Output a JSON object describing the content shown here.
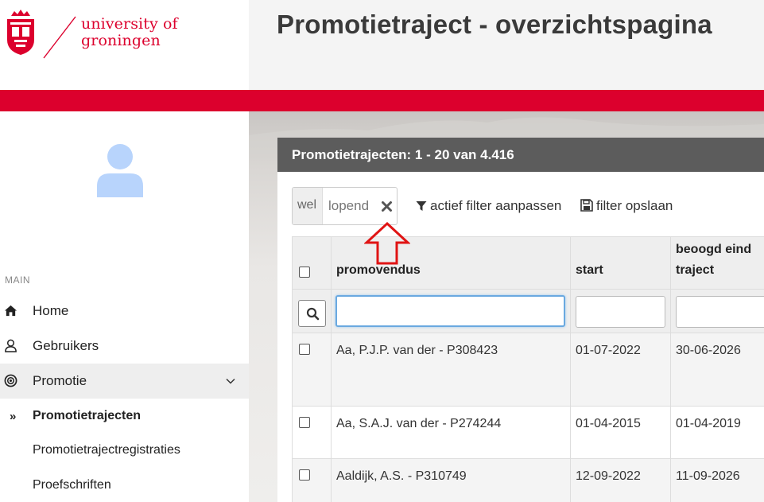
{
  "header": {
    "logo_line1": "university of",
    "logo_line2": "groningen",
    "title": "Promotietraject - overzichtspagina"
  },
  "colors": {
    "brand": "#dc002d",
    "panel_header": "#5c5c5c",
    "avatar": "#b8d4fc",
    "focus": "#6aa9e0"
  },
  "sidebar": {
    "section_label": "MAIN",
    "items": [
      {
        "label": "Home",
        "icon": "home-icon"
      },
      {
        "label": "Gebruikers",
        "icon": "user-icon"
      },
      {
        "label": "Promotie",
        "icon": "target-icon",
        "expanded": true
      }
    ],
    "sub_items": [
      {
        "label": "Promotietrajecten",
        "current": true,
        "bullet": "»"
      },
      {
        "label": "Promotietrajectregistraties"
      },
      {
        "label": "Proefschriften"
      }
    ]
  },
  "panel": {
    "title": "Promotietrajecten: 1 - 20 van 4.416",
    "filter_chip": {
      "key": "wel",
      "value": "lopend"
    },
    "edit_filter_label": "actief filter aanpassen",
    "save_filter_label": "filter opslaan"
  },
  "table": {
    "columns": [
      "promovendus",
      "start",
      "beoogd eind traject"
    ],
    "column_lines": {
      "end": [
        "beoogd eind",
        "traject"
      ]
    },
    "rows": [
      {
        "promovendus": "Aa, P.J.P. van der - P308423",
        "start": "01-07-2022",
        "eind": "30-06-2026"
      },
      {
        "promovendus": "Aa, S.A.J. van der - P274244",
        "start": "01-04-2015",
        "eind": "01-04-2019"
      },
      {
        "promovendus": "Aaldijk, A.S. - P310749",
        "start": "12-09-2022",
        "eind": "11-09-2026"
      }
    ]
  }
}
